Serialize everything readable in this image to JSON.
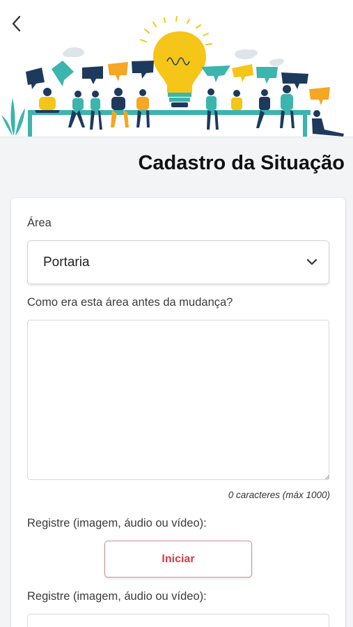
{
  "header": {
    "back_icon": "chevron-left-icon",
    "illustration": "team-ideas-lightbulb-illustration"
  },
  "page": {
    "title": "Cadastro da Situação"
  },
  "form": {
    "area_label": "Área",
    "area_value": "Portaria",
    "before_label": "Como era esta área antes da mudança?",
    "before_value": "",
    "char_count": "0 caracteres (máx 1000)",
    "register_label_1": "Registre (imagem, áudio ou vídeo):",
    "start_button": "Iniciar",
    "register_label_2": "Registre (imagem, áudio ou vídeo):"
  },
  "colors": {
    "accent_red": "#d33a45",
    "bulb_yellow": "#f5c518",
    "teal": "#3bb5ad",
    "navy": "#1d3a5c"
  }
}
